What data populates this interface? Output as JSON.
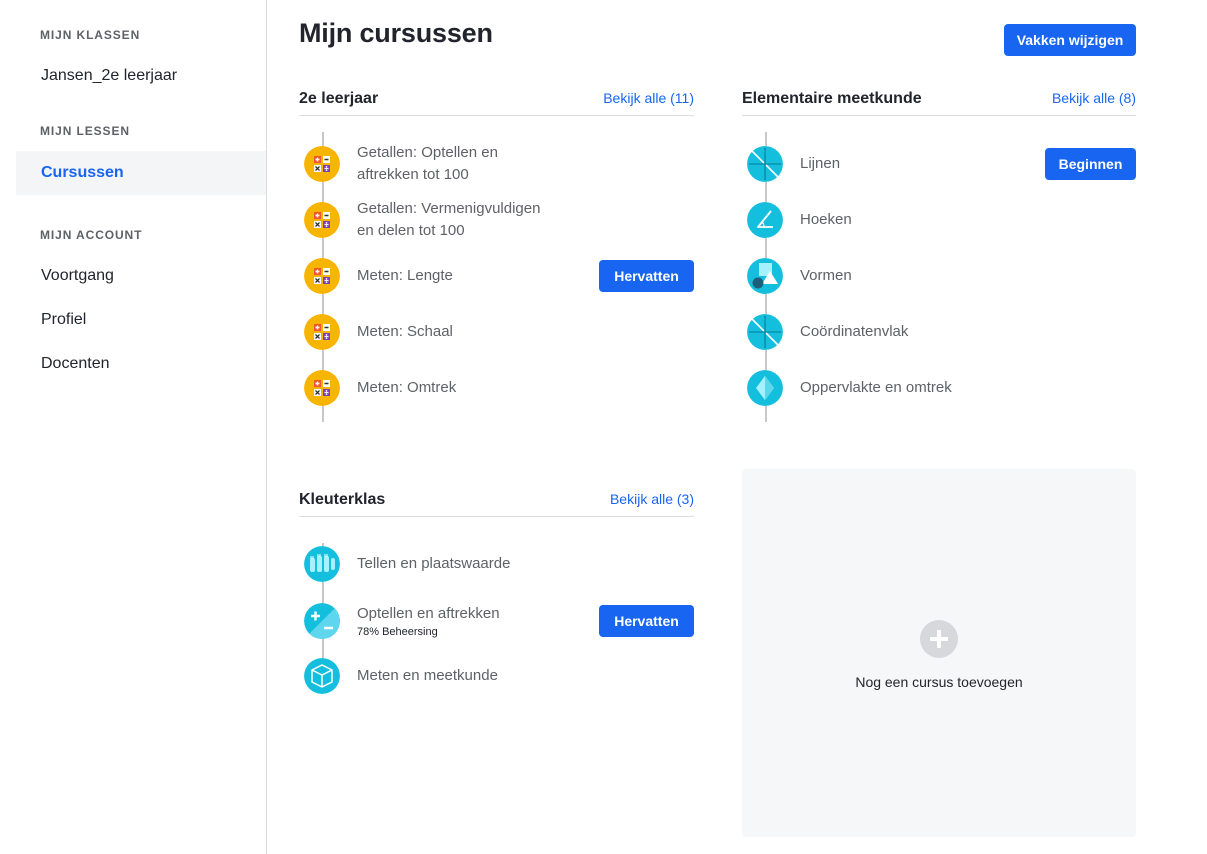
{
  "sidebar": {
    "groups": [
      {
        "title": "MIJN KLASSEN",
        "items": [
          "Jansen_2e leerjaar"
        ]
      },
      {
        "title": "MIJN LESSEN",
        "items": [
          "Cursussen"
        ]
      },
      {
        "title": "MIJN ACCOUNT",
        "items": [
          "Voortgang",
          "Profiel",
          "Docenten"
        ]
      }
    ],
    "active_item": "Cursussen"
  },
  "main": {
    "title": "Mijn cursussen",
    "edit_button": "Vakken wijzigen",
    "courses": [
      {
        "title": "2e leerjaar",
        "link": "Bekijk alle (11)",
        "units": [
          {
            "label": "Getallen: Optellen en aftrekken tot 100",
            "icon": "arithmetic-icon"
          },
          {
            "label": "Getallen: Vermenigvuldigen en delen tot 100",
            "icon": "arithmetic-icon"
          },
          {
            "label": "Meten: Lengte",
            "icon": "arithmetic-icon",
            "button": "Hervatten"
          },
          {
            "label": "Meten: Schaal",
            "icon": "arithmetic-icon"
          },
          {
            "label": "Meten: Omtrek",
            "icon": "arithmetic-icon"
          }
        ]
      },
      {
        "title": "Elementaire meetkunde",
        "link": "Bekijk alle (8)",
        "units": [
          {
            "label": "Lijnen",
            "icon": "lines-icon",
            "button": "Beginnen"
          },
          {
            "label": "Hoeken",
            "icon": "angle-icon"
          },
          {
            "label": "Vormen",
            "icon": "shapes-icon"
          },
          {
            "label": "Coördinatenvlak",
            "icon": "lines-icon"
          },
          {
            "label": "Oppervlakte en omtrek",
            "icon": "diamond-icon"
          }
        ]
      },
      {
        "title": "Kleuterklas",
        "link": "Bekijk alle (3)",
        "units": [
          {
            "label": "Tellen en plaatswaarde",
            "icon": "counting-hands-icon"
          },
          {
            "label": "Optellen en aftrekken",
            "icon": "plus-minus-icon",
            "sub": "78% Beheersing",
            "mastery_percent": 78,
            "button": "Hervatten"
          },
          {
            "label": "Meten en meetkunde",
            "icon": "cube-icon"
          }
        ]
      }
    ],
    "add_course_label": "Nog een cursus toevoegen"
  },
  "colors": {
    "accent": "#1865f2",
    "math_icon_bg": "#f7b500",
    "geometry_icon_bg": "#14bfde",
    "card_bg": "#f6f7f8"
  }
}
